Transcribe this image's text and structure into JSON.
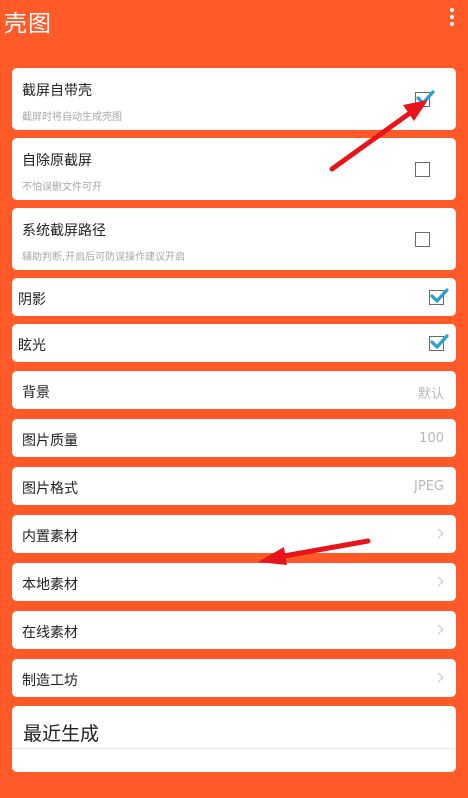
{
  "app": {
    "title": "壳图"
  },
  "settings": [
    {
      "title": "截屏自带壳",
      "subtitle": "截屏时将自动生成壳图",
      "checked": true
    },
    {
      "title": "自除原截屏",
      "subtitle": "不怕误删文件可开",
      "checked": false
    },
    {
      "title": "系统截屏路径",
      "subtitle": "辅助判断,开启后可防误操作建议开启",
      "checked": false
    },
    {
      "title": "阴影",
      "checked": true
    },
    {
      "title": "眩光",
      "checked": true
    },
    {
      "title": "背景",
      "value": "默认"
    },
    {
      "title": "图片质量",
      "value": "100"
    },
    {
      "title": "图片格式",
      "value": "JPEG"
    },
    {
      "title": "内置素材"
    },
    {
      "title": "本地素材"
    },
    {
      "title": "在线素材"
    },
    {
      "title": "制造工坊"
    }
  ],
  "recent": {
    "title": "最近生成"
  },
  "colors": {
    "background": "#ff5a28",
    "checkbox_check": "#2a9fd6",
    "annotation_arrow": "#e8141a"
  },
  "icons": {
    "overflow": "more-vert-icon",
    "chevron": "chevron-right-icon",
    "check": "check-icon"
  }
}
